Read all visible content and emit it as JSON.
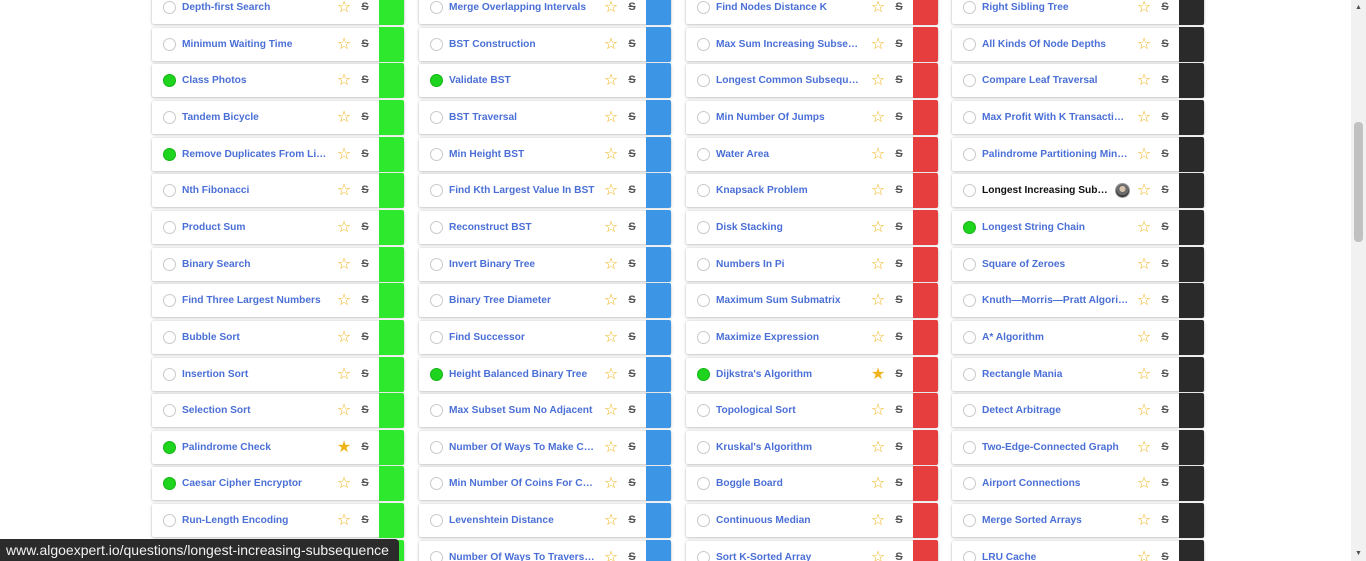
{
  "colors": {
    "easy": "#2ee82e",
    "medium": "#3d95e6",
    "hard": "#e63e3e",
    "very_hard": "#2a2a2a",
    "star": "#f0b41b",
    "link": "#4a6fd6",
    "done": "#1ed41e"
  },
  "icons": {
    "star_empty": "☆",
    "star_filled": "★",
    "strike": "S",
    "scroll_up": "▲",
    "scroll_down": "▼"
  },
  "status_bar": {
    "url": "www.algoexpert.io/questions/longest-increasing-subsequence"
  },
  "columns": [
    {
      "difficulty": "easy",
      "questions": [
        {
          "name": "Depth-first Search",
          "completed": false,
          "starred": false
        },
        {
          "name": "Minimum Waiting Time",
          "completed": false,
          "starred": false
        },
        {
          "name": "Class Photos",
          "completed": true,
          "starred": false
        },
        {
          "name": "Tandem Bicycle",
          "completed": false,
          "starred": false
        },
        {
          "name": "Remove Duplicates From Linked List",
          "completed": true,
          "starred": false
        },
        {
          "name": "Nth Fibonacci",
          "completed": false,
          "starred": false
        },
        {
          "name": "Product Sum",
          "completed": false,
          "starred": false
        },
        {
          "name": "Binary Search",
          "completed": false,
          "starred": false
        },
        {
          "name": "Find Three Largest Numbers",
          "completed": false,
          "starred": false
        },
        {
          "name": "Bubble Sort",
          "completed": false,
          "starred": false
        },
        {
          "name": "Insertion Sort",
          "completed": false,
          "starred": false
        },
        {
          "name": "Selection Sort",
          "completed": false,
          "starred": false
        },
        {
          "name": "Palindrome Check",
          "completed": true,
          "starred": true
        },
        {
          "name": "Caesar Cipher Encryptor",
          "completed": true,
          "starred": false
        },
        {
          "name": "Run-Length Encoding",
          "completed": false,
          "starred": false
        },
        {
          "name": "",
          "completed": false,
          "starred": false
        }
      ]
    },
    {
      "difficulty": "medium",
      "questions": [
        {
          "name": "Merge Overlapping Intervals",
          "completed": false,
          "starred": false
        },
        {
          "name": "BST Construction",
          "completed": false,
          "starred": false
        },
        {
          "name": "Validate BST",
          "completed": true,
          "starred": false
        },
        {
          "name": "BST Traversal",
          "completed": false,
          "starred": false
        },
        {
          "name": "Min Height BST",
          "completed": false,
          "starred": false
        },
        {
          "name": "Find Kth Largest Value In BST",
          "completed": false,
          "starred": false
        },
        {
          "name": "Reconstruct BST",
          "completed": false,
          "starred": false
        },
        {
          "name": "Invert Binary Tree",
          "completed": false,
          "starred": false
        },
        {
          "name": "Binary Tree Diameter",
          "completed": false,
          "starred": false
        },
        {
          "name": "Find Successor",
          "completed": false,
          "starred": false
        },
        {
          "name": "Height Balanced Binary Tree",
          "completed": true,
          "starred": false
        },
        {
          "name": "Max Subset Sum No Adjacent",
          "completed": false,
          "starred": false
        },
        {
          "name": "Number Of Ways To Make Change",
          "completed": false,
          "starred": false
        },
        {
          "name": "Min Number Of Coins For Change",
          "completed": false,
          "starred": false
        },
        {
          "name": "Levenshtein Distance",
          "completed": false,
          "starred": false
        },
        {
          "name": "Number Of Ways To Traverse Graph",
          "completed": false,
          "starred": false
        }
      ]
    },
    {
      "difficulty": "hard",
      "questions": [
        {
          "name": "Find Nodes Distance K",
          "completed": false,
          "starred": false
        },
        {
          "name": "Max Sum Increasing Subsequence",
          "completed": false,
          "starred": false
        },
        {
          "name": "Longest Common Subsequence",
          "completed": false,
          "starred": false
        },
        {
          "name": "Min Number Of Jumps",
          "completed": false,
          "starred": false
        },
        {
          "name": "Water Area",
          "completed": false,
          "starred": false
        },
        {
          "name": "Knapsack Problem",
          "completed": false,
          "starred": false
        },
        {
          "name": "Disk Stacking",
          "completed": false,
          "starred": false
        },
        {
          "name": "Numbers In Pi",
          "completed": false,
          "starred": false
        },
        {
          "name": "Maximum Sum Submatrix",
          "completed": false,
          "starred": false
        },
        {
          "name": "Maximize Expression",
          "completed": false,
          "starred": false
        },
        {
          "name": "Dijkstra's Algorithm",
          "completed": true,
          "starred": true
        },
        {
          "name": "Topological Sort",
          "completed": false,
          "starred": false
        },
        {
          "name": "Kruskal's Algorithm",
          "completed": false,
          "starred": false
        },
        {
          "name": "Boggle Board",
          "completed": false,
          "starred": false
        },
        {
          "name": "Continuous Median",
          "completed": false,
          "starred": false
        },
        {
          "name": "Sort K-Sorted Array",
          "completed": false,
          "starred": false
        }
      ]
    },
    {
      "difficulty": "very_hard",
      "questions": [
        {
          "name": "Right Sibling Tree",
          "completed": false,
          "starred": false
        },
        {
          "name": "All Kinds Of Node Depths",
          "completed": false,
          "starred": false
        },
        {
          "name": "Compare Leaf Traversal",
          "completed": false,
          "starred": false
        },
        {
          "name": "Max Profit With K Transactions",
          "completed": false,
          "starred": false
        },
        {
          "name": "Palindrome Partitioning Min Cuts",
          "completed": false,
          "starred": false
        },
        {
          "name": "Longest Increasing Subsequence",
          "completed": false,
          "starred": false,
          "hovered": true,
          "avatar": true
        },
        {
          "name": "Longest String Chain",
          "completed": true,
          "starred": false
        },
        {
          "name": "Square of Zeroes",
          "completed": false,
          "starred": false
        },
        {
          "name": "Knuth—Morris—Pratt Algorithm",
          "completed": false,
          "starred": false
        },
        {
          "name": "A* Algorithm",
          "completed": false,
          "starred": false
        },
        {
          "name": "Rectangle Mania",
          "completed": false,
          "starred": false
        },
        {
          "name": "Detect Arbitrage",
          "completed": false,
          "starred": false
        },
        {
          "name": "Two-Edge-Connected Graph",
          "completed": false,
          "starred": false
        },
        {
          "name": "Airport Connections",
          "completed": false,
          "starred": false
        },
        {
          "name": "Merge Sorted Arrays",
          "completed": false,
          "starred": false
        },
        {
          "name": "LRU Cache",
          "completed": false,
          "starred": false
        }
      ]
    }
  ]
}
